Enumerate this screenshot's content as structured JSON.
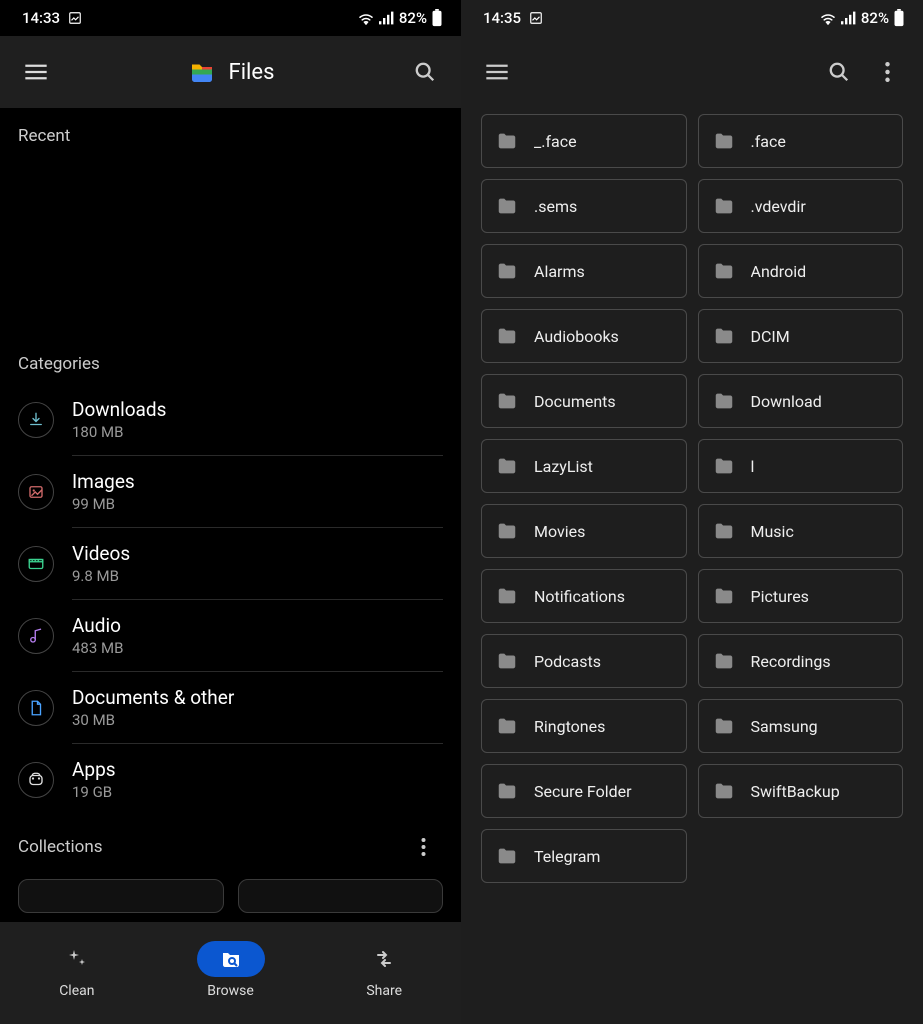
{
  "left": {
    "status": {
      "time": "14:33",
      "battery": "82%"
    },
    "toolbar": {
      "title": "Files"
    },
    "recent_header": "Recent",
    "categories_header": "Categories",
    "categories": [
      {
        "name": "Downloads",
        "size": "180 MB",
        "icon": "download",
        "color": "#6fbfcf"
      },
      {
        "name": "Images",
        "size": "99 MB",
        "icon": "image",
        "color": "#d16a6a"
      },
      {
        "name": "Videos",
        "size": "9.8 MB",
        "icon": "video",
        "color": "#3bd18f"
      },
      {
        "name": "Audio",
        "size": "483 MB",
        "icon": "audio",
        "color": "#b67ff0"
      },
      {
        "name": "Documents & other",
        "size": "30 MB",
        "icon": "doc",
        "color": "#4aa3ff"
      },
      {
        "name": "Apps",
        "size": "19 GB",
        "icon": "apps",
        "color": "#e0e0e0"
      }
    ],
    "collections_header": "Collections",
    "nav": [
      {
        "label": "Clean",
        "icon": "sparkle",
        "active": false
      },
      {
        "label": "Browse",
        "icon": "browse",
        "active": true
      },
      {
        "label": "Share",
        "icon": "share",
        "active": false
      }
    ]
  },
  "right": {
    "status": {
      "time": "14:35",
      "battery": "82%"
    },
    "folders": [
      "_.face",
      ".face",
      ".sems",
      ".vdevdir",
      "Alarms",
      "Android",
      "Audiobooks",
      "DCIM",
      "Documents",
      "Download",
      "LazyList",
      "l",
      "Movies",
      "Music",
      "Notifications",
      "Pictures",
      "Podcasts",
      "Recordings",
      "Ringtones",
      "Samsung",
      "Secure Folder",
      "SwiftBackup",
      "Telegram"
    ]
  }
}
